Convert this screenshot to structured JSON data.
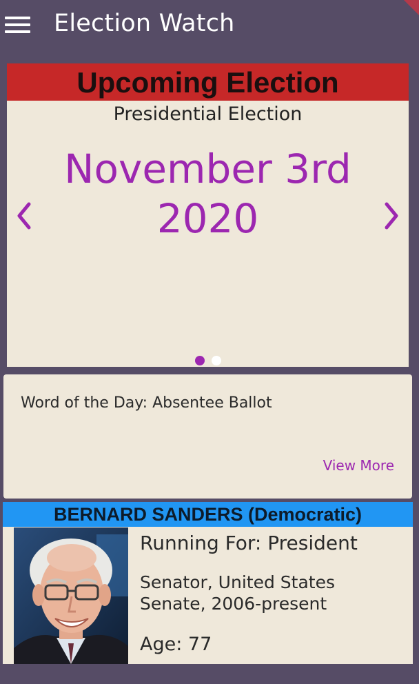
{
  "appbar": {
    "title": "Election Watch",
    "menu_icon": "menu-icon"
  },
  "carousel": {
    "header": "Upcoming Election",
    "election_type": "Presidential Election",
    "date_line1": "November 3rd",
    "date_line2": "2020",
    "prev_icon": "chevron-left-icon",
    "next_icon": "chevron-right-icon",
    "page_count": 2,
    "active_page": 0
  },
  "word_of_day": {
    "text": "Word of the Day: Absentee Ballot",
    "link": "View More"
  },
  "candidate": {
    "header": "BERNARD SANDERS (Democratic)",
    "running_for": "Running For: President",
    "position_line1": "Senator, United States",
    "position_line2": "Senate, 2006-present",
    "age": "Age: 77"
  },
  "colors": {
    "background": "#564c66",
    "accent": "#9c27b0",
    "election_header": "#c62828",
    "candidate_header": "#2196f3",
    "card": "#efe8da"
  }
}
